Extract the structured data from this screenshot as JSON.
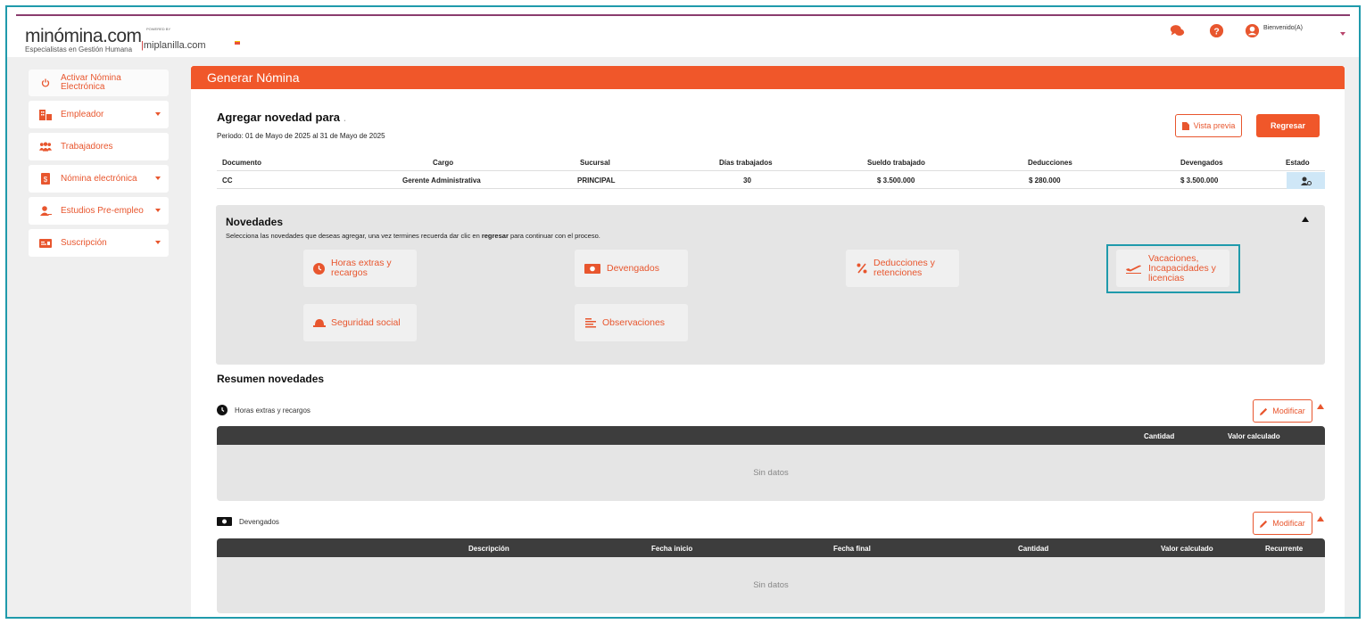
{
  "header": {
    "logo_main": "minómina.com",
    "logo_sub": "Especialistas en Gestión Humana",
    "powered_by": "POWERED BY",
    "miplanilla": "miplanilla.com",
    "welcome": "Bienvenido(A)"
  },
  "sidebar": {
    "items": [
      {
        "label": "Activar Nómina Electrónica",
        "icon": "power-icon"
      },
      {
        "label": "Empleador",
        "icon": "building-icon"
      },
      {
        "label": "Trabajadores",
        "icon": "users-icon"
      },
      {
        "label": "Nómina electrónica",
        "icon": "document-dollar-icon"
      },
      {
        "label": "Estudios Pre-empleo",
        "icon": "user-plus-icon"
      },
      {
        "label": "Suscripción",
        "icon": "card-icon"
      }
    ]
  },
  "main": {
    "header_title": "Generar Nómina",
    "title": "Agregar novedad para",
    "title_suffix": ".",
    "period": "Periodo: 01 de Mayo de 2025 al 31 de Mayo de 2025",
    "preview_label": "Vista previa",
    "back_label": "Regresar"
  },
  "employee_table": {
    "headers": [
      "Documento",
      "Cargo",
      "Sucursal",
      "Días trabajados",
      "Sueldo trabajado",
      "Deducciones",
      "Devengados",
      "Estado"
    ],
    "row": {
      "documento": "CC",
      "cargo": "Gerente Administrativa",
      "sucursal": "PRINCIPAL",
      "dias": "30",
      "sueldo": "$ 3.500.000",
      "deducciones": "$ 280.000",
      "devengados": "$ 3.500.000"
    }
  },
  "novedades": {
    "title": "Novedades",
    "desc_before": "Selecciona las novedades que deseas agregar, una vez termines recuerda dar clic en ",
    "desc_bold": "regresar",
    "desc_after": " para continuar con el proceso.",
    "buttons": {
      "horas": "Horas extras y recargos",
      "devengados": "Devengados",
      "deducciones": "Deducciones y retenciones",
      "vacaciones": "Vacaciones, Incapacidades y licencias",
      "seguridad": "Seguridad social",
      "observaciones": "Observaciones"
    }
  },
  "resumen": {
    "title": "Resumen novedades",
    "modify_label": "Modificar",
    "horas": {
      "label": "Horas extras y recargos",
      "headers": [
        "Cantidad",
        "Valor calculado"
      ],
      "empty": "Sin datos"
    },
    "devengados": {
      "label": "Devengados",
      "headers": [
        "Descripción",
        "Fecha inicio",
        "Fecha final",
        "Cantidad",
        "Valor calculado",
        "Recurrente"
      ],
      "empty": "Sin datos"
    }
  },
  "colors": {
    "accent": "#f0572a",
    "highlight": "#1f9aab",
    "table_header": "#3d3d3d"
  }
}
